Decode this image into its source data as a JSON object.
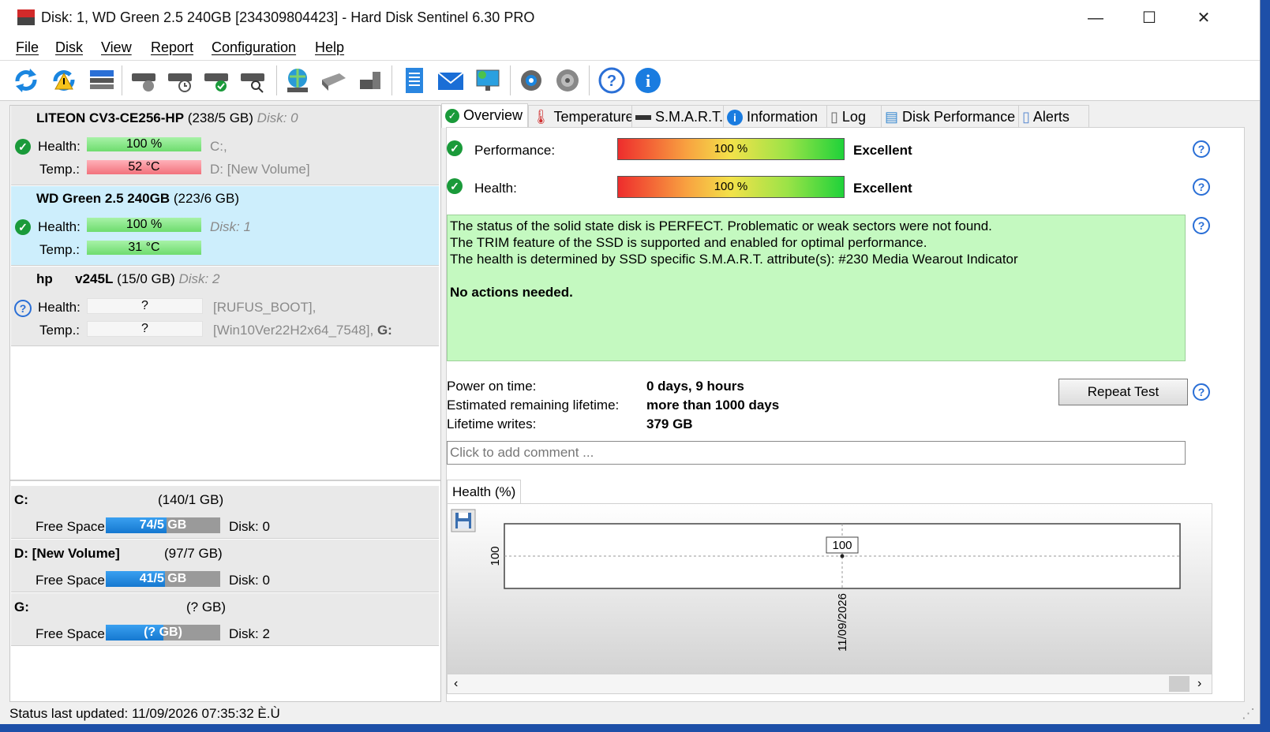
{
  "window": {
    "title": "Disk: 1, WD Green 2.5 240GB [234309804423]  -  Hard Disk Sentinel 6.30 PRO",
    "minimize_symbol": "—",
    "maximize_symbol": "☐",
    "close_symbol": "✕"
  },
  "menu": [
    "File",
    "Disk",
    "View",
    "Report",
    "Configuration",
    "Help"
  ],
  "toolbar": {
    "icons": [
      "refresh-icon",
      "refresh-warning-icon",
      "disk-list-icon",
      "disk-test-icon",
      "disk-schedule-icon",
      "disk-check-icon",
      "disk-search-icon",
      "network-icon",
      "usb-disk-icon",
      "external-disk-icon",
      "report-icon",
      "email-icon",
      "monitor-icon",
      "settings-icon",
      "sound-icon",
      "help-icon",
      "info-icon"
    ]
  },
  "disks": [
    {
      "model": "LITEON CV3-CE256-HP",
      "size": "(238/5 GB)",
      "disk_label": "Disk: 0",
      "health_label": "Health:",
      "health": "100 %",
      "temp_label": "Temp.:",
      "temp": "52 °C",
      "volumes_line1": "C:,",
      "volumes_line2": "D: [New Volume]"
    },
    {
      "model": "WD Green 2.5 240GB",
      "size": "(223/6 GB)",
      "disk_label": "Disk: 1",
      "health_label": "Health:",
      "health": "100 %",
      "temp_label": "Temp.:",
      "temp": "31 °C"
    },
    {
      "model_prefix": "hp",
      "model": "v245L",
      "size": "(15/0 GB)",
      "disk_label": "Disk: 2",
      "health_label": "Health:",
      "health": "?",
      "temp_label": "Temp.:",
      "temp": "?",
      "volumes_line1": "[RUFUS_BOOT],",
      "volumes_line2": "[Win10Ver22H2x64_7548],",
      "volumes_line2_drive": "G:"
    }
  ],
  "volumes": [
    {
      "name": "C:",
      "size": "(140/1 GB)",
      "free_label": "Free Space",
      "free": "74/5 GB",
      "disk": "Disk: 0",
      "free_fraction": 0.53
    },
    {
      "name": "D: [New Volume]",
      "size": "(97/7 GB)",
      "free_label": "Free Space",
      "free": "41/5 GB",
      "disk": "Disk: 0",
      "free_fraction": 0.42
    },
    {
      "name": "G:",
      "size": "(? GB)",
      "free_label": "Free Space",
      "free": "(? GB)",
      "disk": "Disk: 2",
      "free_fraction": 0.5
    }
  ],
  "tabs": [
    "Overview",
    "Temperature",
    "S.M.A.R.T.",
    "Information",
    "Log",
    "Disk Performance",
    "Alerts"
  ],
  "overview": {
    "performance_label": "Performance:",
    "performance_value": "100 %",
    "performance_rating": "Excellent",
    "health_label": "Health:",
    "health_value": "100 %",
    "health_rating": "Excellent",
    "status_lines": [
      "The status of the solid state disk is PERFECT. Problematic or weak sectors were not found.",
      "The TRIM feature of the SSD is supported and enabled for optimal performance.",
      "The health is determined by SSD specific S.M.A.R.T. attribute(s):  #230 Media Wearout Indicator"
    ],
    "status_action": "No actions needed.",
    "power_on_label": "Power on time:",
    "power_on_value": "0 days, 9 hours",
    "lifetime_label": "Estimated remaining lifetime:",
    "lifetime_value": "more than 1000 days",
    "writes_label": "Lifetime writes:",
    "writes_value": "379 GB",
    "repeat_button": "Repeat Test",
    "comment_placeholder": "Click to add comment ...",
    "chart_tab": "Health (%)",
    "help_symbol": "?"
  },
  "chart_data": {
    "type": "line",
    "x": [
      "11/09/2026"
    ],
    "values": [
      100
    ],
    "ylabel_tick": "100",
    "point_label": "100"
  },
  "statusbar": {
    "text": "Status last updated: 11/09/2026 07:35:32 È.Ù"
  }
}
